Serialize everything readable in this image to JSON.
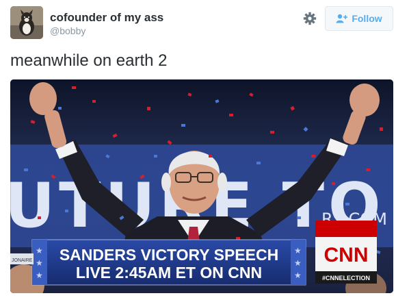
{
  "user": {
    "display_name": "cofounder of my ass",
    "handle": "@bobby",
    "avatar_icon": "dog-avatar"
  },
  "actions": {
    "settings_icon": "gear-icon",
    "follow_label": "Follow",
    "follow_icon": "add-user-icon"
  },
  "tweet": {
    "text": "meanwhile on earth 2"
  },
  "media": {
    "background_sign_text": "UTURE TO BE",
    "background_sign_small": "RS.COM",
    "chyron_line1": "SANDERS VICTORY SPEECH",
    "chyron_line2": "LIVE 2:45AM ET ON CNN",
    "side_tag": "JONAIRE",
    "cnn_logo": "CNN",
    "hashtag": "#CNNELECTION"
  },
  "colors": {
    "accent": "#55acee",
    "cnn_red": "#cc0000",
    "chyron_blue": "#1f3b8e"
  }
}
